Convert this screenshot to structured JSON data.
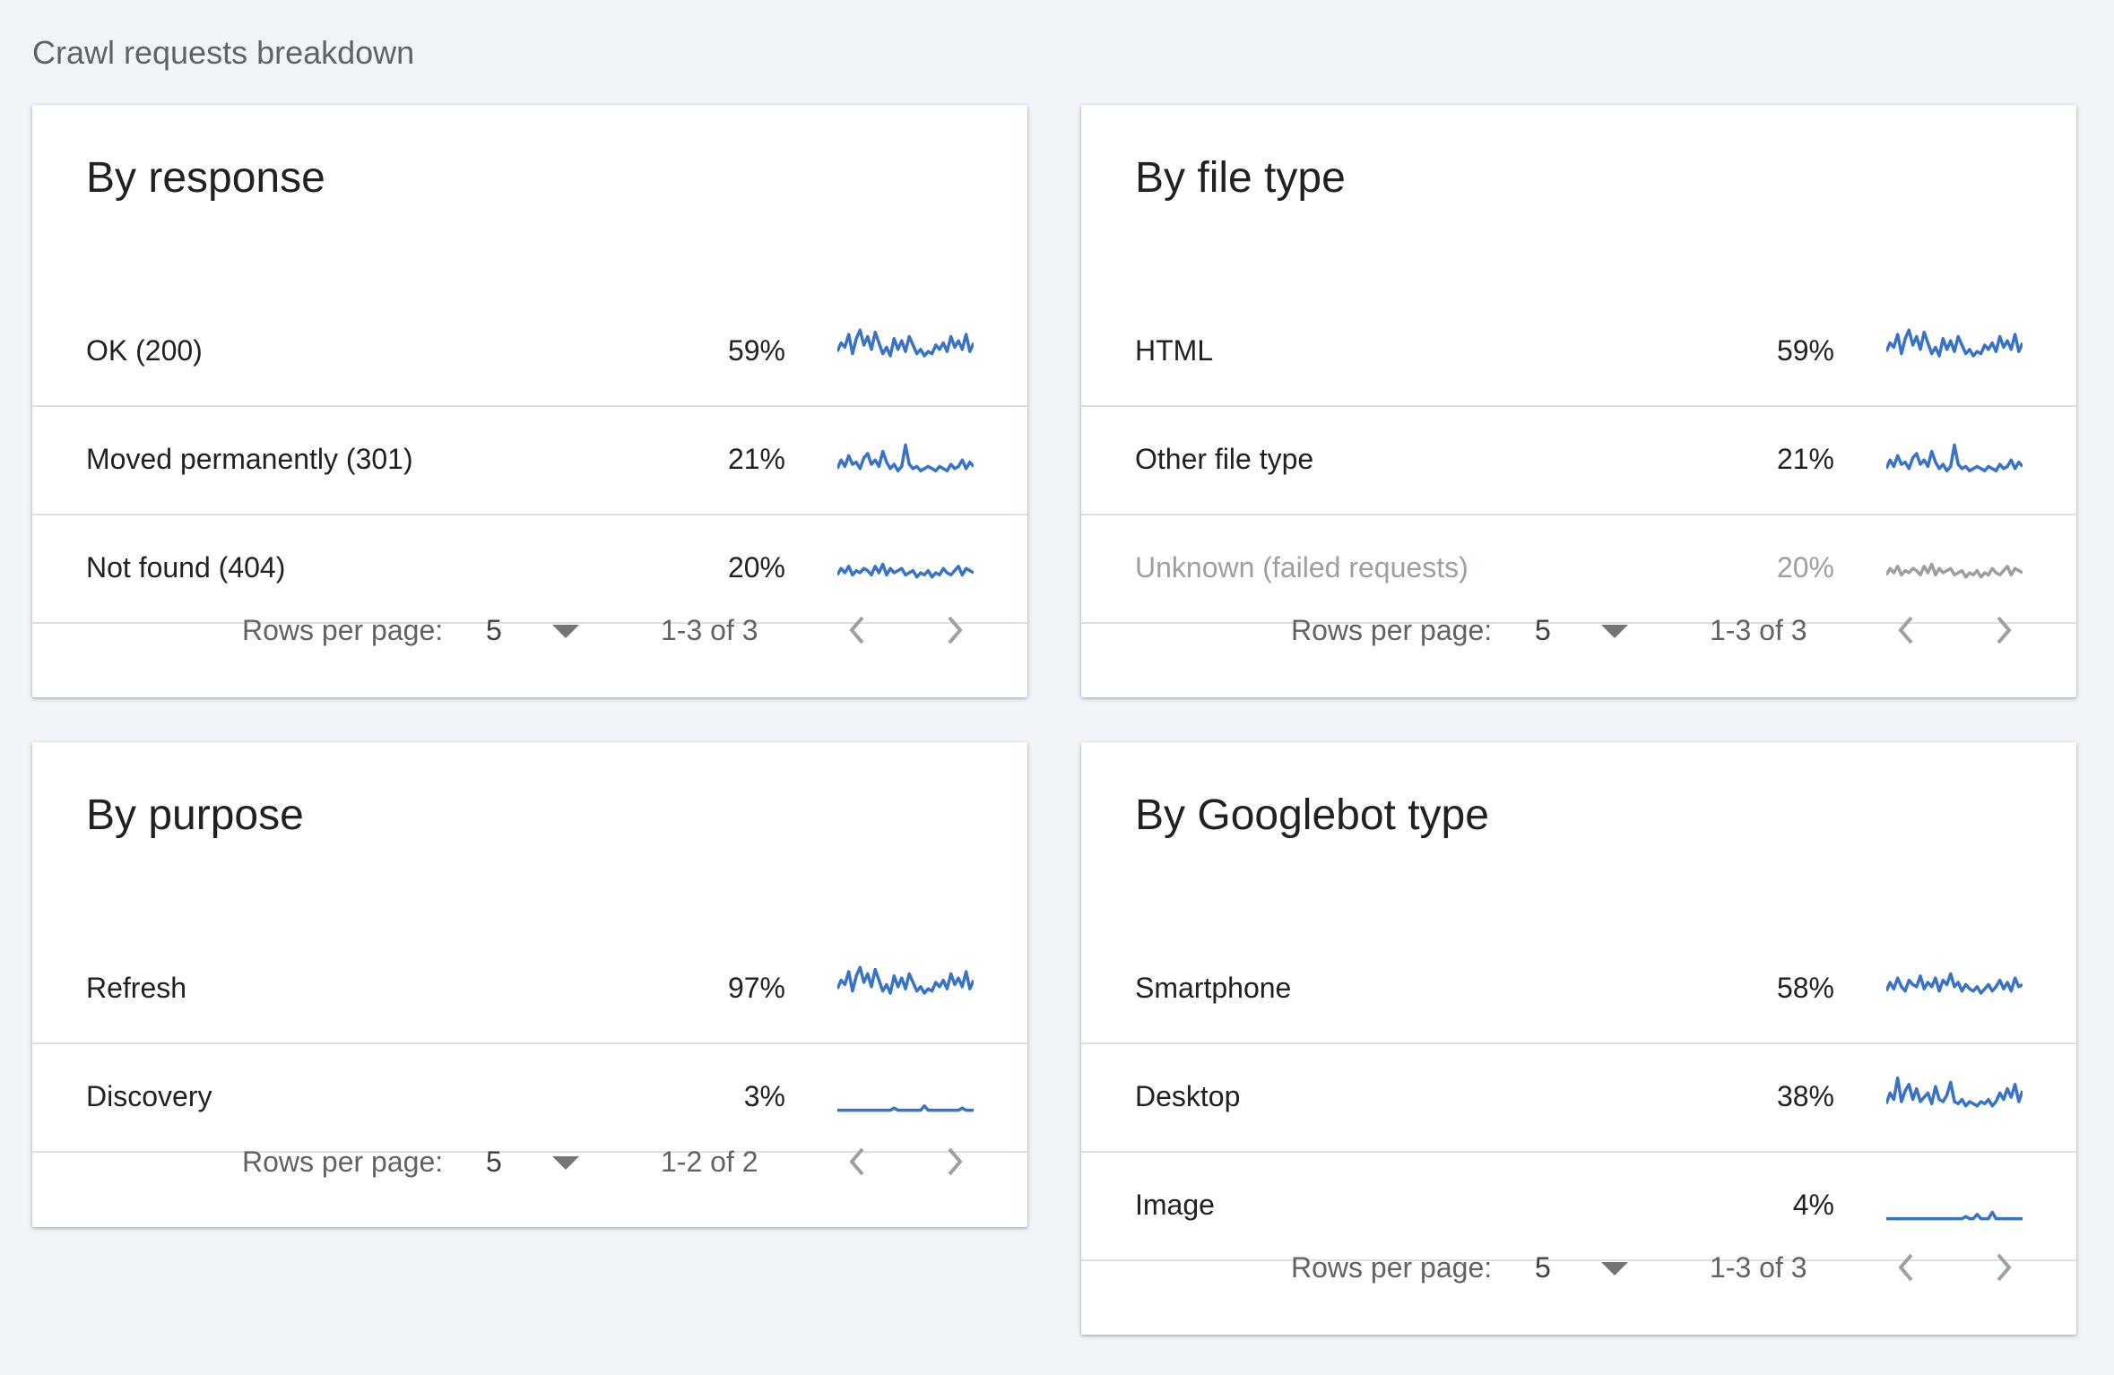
{
  "page": {
    "title": "Crawl requests breakdown"
  },
  "colors": {
    "spark_active": "#3873c8",
    "spark_muted": "#9e9e9e"
  },
  "pagination_label": "Rows per page:",
  "cards": {
    "response": {
      "title": "By response",
      "rows": [
        {
          "label": "OK (200)",
          "pct": "59%",
          "spark": [
            14,
            22,
            18,
            30,
            12,
            26,
            34,
            20,
            28,
            16,
            32,
            22,
            12,
            18,
            10,
            26,
            16,
            24,
            14,
            28,
            20,
            12,
            16,
            10,
            14,
            12,
            20,
            16,
            22,
            14,
            28,
            18,
            24,
            16,
            30,
            14,
            22
          ]
        },
        {
          "label": "Moved permanently (301)",
          "pct": "21%",
          "spark": [
            6,
            14,
            8,
            18,
            10,
            12,
            6,
            16,
            20,
            10,
            14,
            8,
            22,
            12,
            6,
            10,
            4,
            8,
            28,
            10,
            6,
            8,
            4,
            6,
            8,
            6,
            4,
            8,
            6,
            4,
            10,
            6,
            8,
            14,
            6,
            12,
            8
          ]
        },
        {
          "label": "Not found (404)",
          "pct": "20%",
          "spark": [
            8,
            14,
            10,
            16,
            8,
            12,
            10,
            14,
            12,
            8,
            16,
            10,
            18,
            8,
            14,
            10,
            12,
            14,
            8,
            10,
            12,
            6,
            10,
            8,
            12,
            6,
            10,
            8,
            14,
            10,
            8,
            12,
            16,
            8,
            14,
            12,
            10
          ]
        }
      ],
      "rows_per_page": "5",
      "range": "1-3 of 3"
    },
    "filetype": {
      "title": "By file type",
      "rows": [
        {
          "label": "HTML",
          "pct": "59%",
          "spark": [
            14,
            22,
            18,
            30,
            12,
            26,
            34,
            20,
            28,
            16,
            32,
            22,
            12,
            18,
            10,
            26,
            16,
            24,
            14,
            28,
            20,
            12,
            16,
            10,
            14,
            12,
            20,
            16,
            22,
            14,
            28,
            18,
            24,
            16,
            30,
            14,
            22
          ],
          "muted": false
        },
        {
          "label": "Other file type",
          "pct": "21%",
          "spark": [
            6,
            14,
            8,
            18,
            10,
            12,
            6,
            16,
            20,
            10,
            14,
            8,
            22,
            12,
            6,
            10,
            4,
            8,
            28,
            10,
            6,
            8,
            4,
            6,
            8,
            6,
            4,
            8,
            6,
            4,
            10,
            6,
            8,
            14,
            6,
            12,
            8
          ],
          "muted": false
        },
        {
          "label": "Unknown (failed requests)",
          "pct": "20%",
          "spark": [
            8,
            14,
            10,
            16,
            8,
            12,
            10,
            14,
            12,
            8,
            16,
            10,
            18,
            8,
            14,
            10,
            12,
            14,
            8,
            10,
            12,
            6,
            10,
            8,
            12,
            6,
            10,
            8,
            14,
            10,
            8,
            12,
            16,
            8,
            14,
            12,
            10
          ],
          "muted": true
        }
      ],
      "rows_per_page": "5",
      "range": "1-3 of 3"
    },
    "purpose": {
      "title": "By purpose",
      "rows": [
        {
          "label": "Refresh",
          "pct": "97%",
          "spark": [
            14,
            22,
            18,
            30,
            12,
            26,
            34,
            20,
            28,
            16,
            32,
            22,
            12,
            18,
            10,
            26,
            16,
            24,
            14,
            28,
            20,
            12,
            16,
            10,
            14,
            12,
            20,
            16,
            22,
            14,
            28,
            18,
            24,
            16,
            30,
            14,
            22
          ]
        },
        {
          "label": "Discovery",
          "pct": "3%",
          "spark": [
            2,
            2,
            2,
            2,
            2,
            2,
            2,
            2,
            2,
            2,
            2,
            2,
            2,
            2,
            2,
            4,
            2,
            2,
            2,
            2,
            2,
            2,
            2,
            6,
            2,
            2,
            2,
            2,
            2,
            2,
            2,
            2,
            2,
            4,
            2,
            2,
            2
          ]
        }
      ],
      "rows_per_page": "5",
      "range": "1-2 of 2"
    },
    "googlebot": {
      "title": "By Googlebot type",
      "rows": [
        {
          "label": "Smartphone",
          "pct": "58%",
          "spark": [
            12,
            20,
            14,
            24,
            16,
            12,
            22,
            18,
            16,
            26,
            14,
            20,
            16,
            24,
            12,
            22,
            18,
            28,
            16,
            20,
            12,
            18,
            14,
            12,
            16,
            10,
            14,
            18,
            12,
            16,
            22,
            14,
            20,
            12,
            24,
            16,
            18
          ]
        },
        {
          "label": "Desktop",
          "pct": "38%",
          "spark": [
            8,
            18,
            12,
            32,
            10,
            20,
            26,
            12,
            22,
            10,
            14,
            18,
            8,
            24,
            12,
            10,
            16,
            28,
            10,
            8,
            12,
            6,
            10,
            8,
            6,
            10,
            8,
            12,
            6,
            10,
            18,
            12,
            22,
            14,
            26,
            10,
            20
          ]
        },
        {
          "label": "Image",
          "pct": "4%",
          "spark": [
            2,
            2,
            2,
            2,
            2,
            2,
            2,
            2,
            2,
            2,
            2,
            2,
            2,
            2,
            2,
            2,
            2,
            2,
            2,
            2,
            2,
            4,
            2,
            2,
            6,
            2,
            2,
            2,
            8,
            2,
            2,
            2,
            2,
            2,
            2,
            2,
            2
          ]
        }
      ],
      "rows_per_page": "5",
      "range": "1-3 of 3"
    }
  }
}
